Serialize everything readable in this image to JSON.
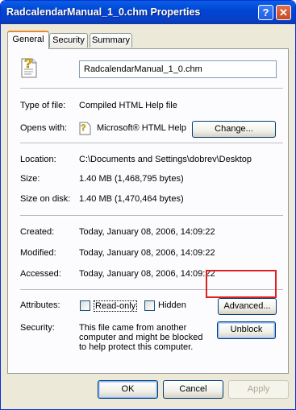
{
  "window": {
    "title": "RadcalendarManual_1_0.chm Properties",
    "help_glyph": "?",
    "close_glyph": "✕"
  },
  "tabs": [
    {
      "label": "General",
      "active": true
    },
    {
      "label": "Security",
      "active": false
    },
    {
      "label": "Summary",
      "active": false
    }
  ],
  "general": {
    "file_icon": "help-file-icon",
    "filename": "RadcalendarManual_1_0.chm",
    "type_label": "Type of file:",
    "type_value": "Compiled HTML Help file",
    "opens_label": "Opens with:",
    "opens_value": "Microsoft® HTML Help",
    "change_button": "Change...",
    "location_label": "Location:",
    "location_value": "C:\\Documents and Settings\\dobrev\\Desktop",
    "size_label": "Size:",
    "size_value": "1.40 MB (1,468,795 bytes)",
    "size_disk_label": "Size on disk:",
    "size_disk_value": "1.40 MB (1,470,464 bytes)",
    "created_label": "Created:",
    "created_value": "Today, January 08, 2006, 14:09:22",
    "modified_label": "Modified:",
    "modified_value": "Today, January 08, 2006, 14:09:22",
    "accessed_label": "Accessed:",
    "accessed_value": "Today, January 08, 2006, 14:09:22",
    "attributes_label": "Attributes:",
    "readonly_label": "Read-only",
    "readonly_checked": false,
    "hidden_label": "Hidden",
    "hidden_checked": false,
    "advanced_button": "Advanced...",
    "security_label": "Security:",
    "security_text": "This file came from another computer and might be blocked to help protect this computer.",
    "unblock_button": "Unblock"
  },
  "footer": {
    "ok": "OK",
    "cancel": "Cancel",
    "apply": "Apply",
    "apply_enabled": false
  },
  "colors": {
    "titlebar": "#0a5fe5",
    "highlight_box": "#e02020",
    "window_bg": "#ece9d8"
  }
}
